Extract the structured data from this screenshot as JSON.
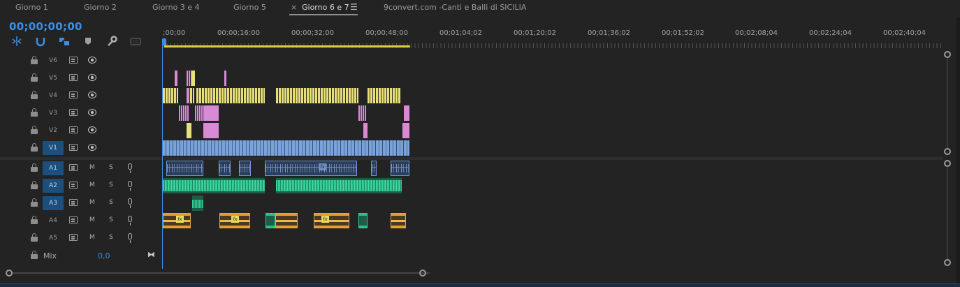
{
  "tabs": [
    {
      "label": "Giorno 1"
    },
    {
      "label": "Giorno 2"
    },
    {
      "label": "Giorno 3 e 4"
    },
    {
      "label": "Giorno 5"
    },
    {
      "label": "Giorno 6 e 7",
      "active": true,
      "close_glyph": "×",
      "menu_glyph": "☰"
    },
    {
      "label": "9convert.com -Canti e Balli di SICILIA"
    }
  ],
  "timecode": "00;00;00;00",
  "toolbar": {
    "icons": [
      "snap-insert-icon",
      "magnet-icon",
      "linked-selection-icon",
      "add-marker-icon",
      "wrench-icon",
      "captions-icon"
    ]
  },
  "ruler": {
    "labels": [
      ";00;00",
      "00;00;16;00",
      "00;00;32;00",
      "00;00;48;00",
      "00;01;04;02",
      "00;01;20;02",
      "00;01;36;02",
      "00;01;52;02",
      "00;02;08;04",
      "00;02;24;04",
      "00;02;40;04"
    ]
  },
  "video_tracks": [
    {
      "name": "V6"
    },
    {
      "name": "V5"
    },
    {
      "name": "V4"
    },
    {
      "name": "V3"
    },
    {
      "name": "V2"
    },
    {
      "name": "V1",
      "targeted": true
    }
  ],
  "audio_tracks": [
    {
      "name": "A1",
      "targeted": true,
      "mute": "M",
      "solo": "S"
    },
    {
      "name": "A2",
      "targeted": true,
      "mute": "M",
      "solo": "S"
    },
    {
      "name": "A3",
      "targeted": true,
      "mute": "M",
      "solo": "S"
    },
    {
      "name": "A4",
      "mute": "M",
      "solo": "S"
    },
    {
      "name": "A5",
      "mute": "M",
      "solo": "S"
    }
  ],
  "mix": {
    "label": "Mix",
    "value": "0,0",
    "glyph": "⧓"
  },
  "fx_label": "fx",
  "colors": {
    "accent": "#3a8ee6",
    "work_area": "#d9cf42",
    "video_yellow": "#e8e07c",
    "video_pink": "#d88ad6",
    "video_blue": "#7aa3db",
    "audio_green": "#2fb987",
    "audio_orange": "#e69b2f"
  }
}
